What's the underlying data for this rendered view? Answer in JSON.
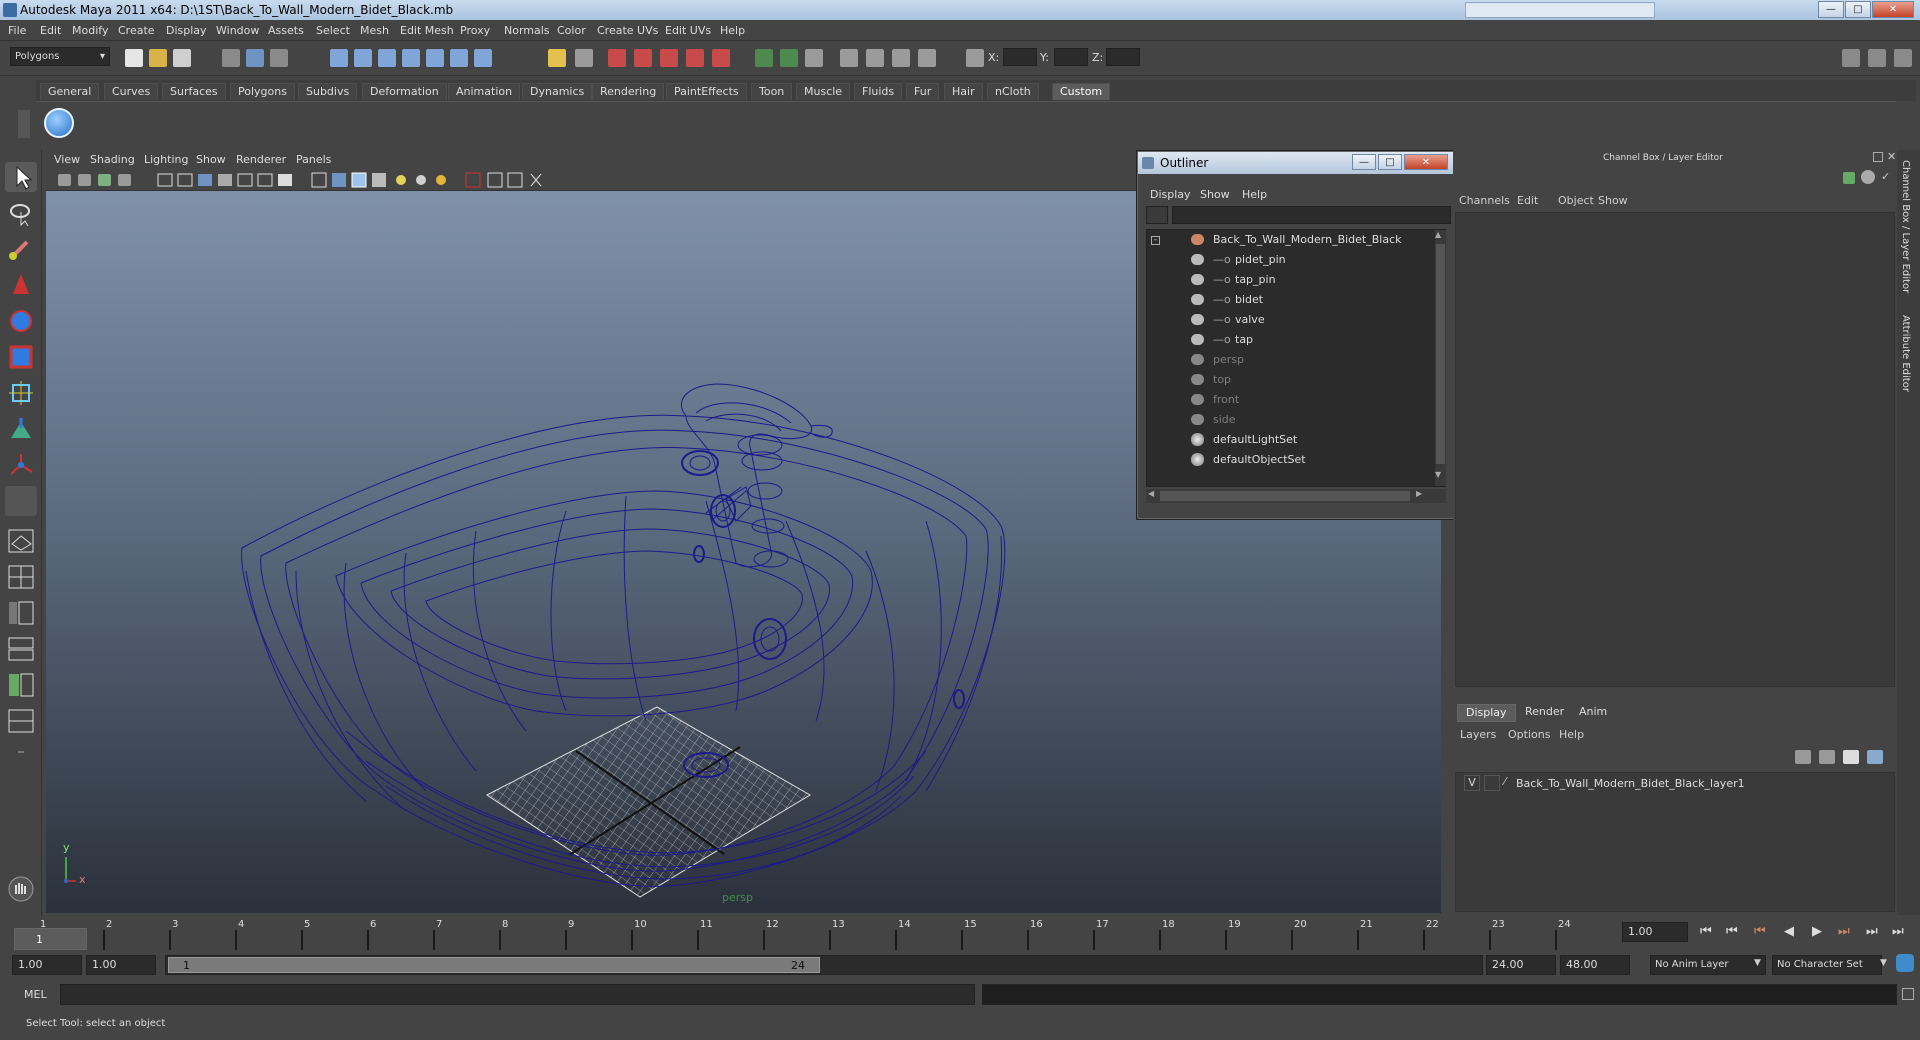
{
  "window": {
    "title": "Autodesk Maya 2011 x64: D:\\1ST\\Back_To_Wall_Modern_Bidet_Black.mb"
  },
  "menubar": [
    "File",
    "Edit",
    "Modify",
    "Create",
    "Display",
    "Window",
    "Assets",
    "Select",
    "Mesh",
    "Edit Mesh",
    "Proxy",
    "Normals",
    "Color",
    "Create UVs",
    "Edit UVs",
    "Help"
  ],
  "toolbar": {
    "mode": "Polygons",
    "x_label": "X:",
    "y_label": "Y:",
    "z_label": "Z:"
  },
  "shelf_tabs": [
    "General",
    "Curves",
    "Surfaces",
    "Polygons",
    "Subdivs",
    "Deformation",
    "Animation",
    "Dynamics",
    "Rendering",
    "PaintEffects",
    "Toon",
    "Muscle",
    "Fluids",
    "Fur",
    "Hair",
    "nCloth",
    "Custom"
  ],
  "shelf_active": "Custom",
  "viewport": {
    "menus": [
      "View",
      "Shading",
      "Lighting",
      "Show",
      "Renderer",
      "Panels"
    ],
    "camera_label": "persp",
    "axis_y": "y",
    "axis_x": "x"
  },
  "outliner": {
    "title": "Outliner",
    "menus": [
      "Display",
      "Show",
      "Help"
    ],
    "items": [
      {
        "label": "Back_To_Wall_Modern_Bidet_Black",
        "dim": false
      },
      {
        "label": "pidet_pin",
        "dim": false
      },
      {
        "label": "tap_pin",
        "dim": false
      },
      {
        "label": "bidet",
        "dim": false
      },
      {
        "label": "valve",
        "dim": false
      },
      {
        "label": "tap",
        "dim": false
      },
      {
        "label": "persp",
        "dim": true
      },
      {
        "label": "top",
        "dim": true
      },
      {
        "label": "front",
        "dim": true
      },
      {
        "label": "side",
        "dim": true
      },
      {
        "label": "defaultLightSet",
        "dim": false
      },
      {
        "label": "defaultObjectSet",
        "dim": false
      }
    ]
  },
  "channel_box": {
    "title": "Channel Box / Layer Editor",
    "menus": [
      "Channels",
      "Edit",
      "Object",
      "Show"
    ]
  },
  "side_tabs": {
    "channel": "Channel Box / Layer Editor",
    "attr": "Attribute Editor"
  },
  "layer_editor": {
    "tabs": [
      "Display",
      "Render",
      "Anim"
    ],
    "menus": [
      "Layers",
      "Options",
      "Help"
    ],
    "layer": {
      "visibility": "V",
      "name": "Back_To_Wall_Modern_Bidet_Black_layer1"
    }
  },
  "timeline": {
    "ticks": [
      "1",
      "2",
      "3",
      "4",
      "5",
      "6",
      "7",
      "8",
      "9",
      "10",
      "11",
      "12",
      "13",
      "14",
      "15",
      "16",
      "17",
      "18",
      "19",
      "20",
      "21",
      "22",
      "23",
      "24"
    ],
    "current_frame": "1",
    "current_time_field": "1.00"
  },
  "range": {
    "start": "1.00",
    "anim_start": "1.00",
    "range_start_label": "1",
    "range_end_label": "24",
    "end": "24.00",
    "anim_end": "48.00",
    "anim_layer": "No Anim Layer",
    "character_set": "No Character Set"
  },
  "command": {
    "label": "MEL"
  },
  "help_line": "Select Tool: select an object",
  "colors": {
    "wire": "#1d1a8a",
    "grid": "#d8d8d8",
    "accent": "#5c5c5c"
  }
}
